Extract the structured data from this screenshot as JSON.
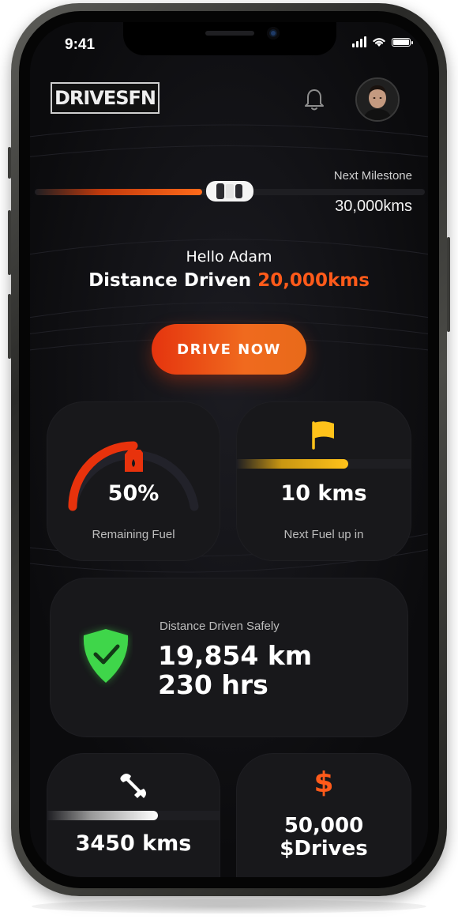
{
  "status_bar": {
    "time": "9:41"
  },
  "header": {
    "logo_text": "DRIVESFN"
  },
  "milestone": {
    "label": "Next Milestone",
    "value": "30,000kms",
    "progress": 0.55
  },
  "greeting": {
    "hello": "Hello Adam",
    "distance_label": "Distance Driven",
    "distance_value": "20,000kms"
  },
  "cta": {
    "drive_now": "DRIVE NOW"
  },
  "fuel_card": {
    "value": "50%",
    "label": "Remaining Fuel",
    "fuel_level": 0.5
  },
  "next_fuel_card": {
    "value": "10 kms",
    "label": "Next Fuel up in",
    "progress": 0.64
  },
  "safety_card": {
    "label": "Distance Driven Safely",
    "km": "19,854 km",
    "hrs": "230 hrs"
  },
  "service_card": {
    "value": "3450 kms",
    "progress": 0.64
  },
  "drives_card": {
    "symbol": "$",
    "amount": "50,000",
    "unit": "$Drives"
  },
  "colors": {
    "accent": "#ff5a1a",
    "background": "#0b0b0d",
    "card": "#18181b",
    "safe_green": "#3fd64a",
    "flag_yellow": "#ffc21a"
  }
}
